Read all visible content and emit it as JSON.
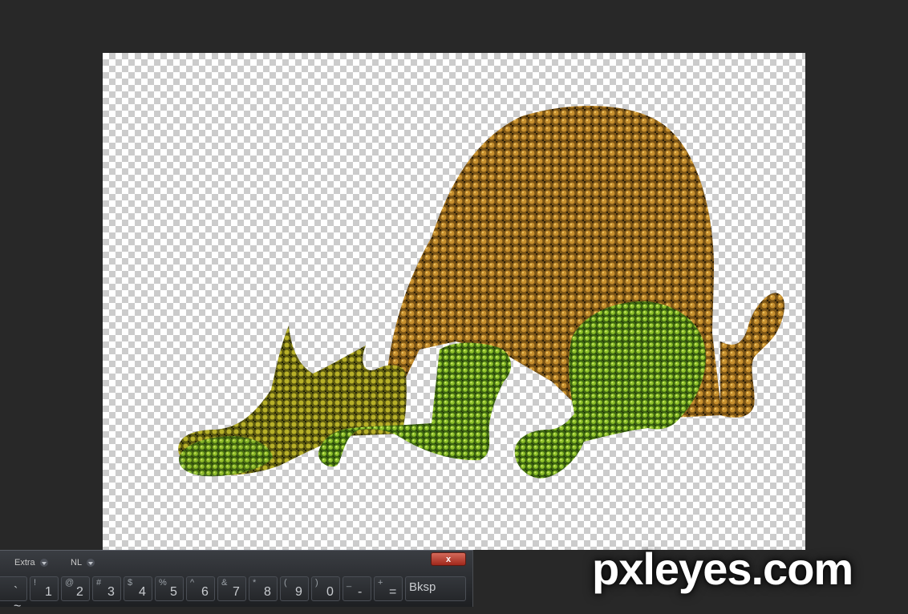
{
  "canvas": {
    "figure": "textured-animal-illustration"
  },
  "keyboard": {
    "dropdown_extra": "Extra",
    "dropdown_layout": "NL",
    "close_label": "x",
    "keys": [
      {
        "top": "",
        "main": "` ~"
      },
      {
        "top": "!",
        "main": "1"
      },
      {
        "top": "@",
        "main": "2"
      },
      {
        "top": "#",
        "main": "3"
      },
      {
        "top": "$",
        "main": "4"
      },
      {
        "top": "%",
        "main": "5"
      },
      {
        "top": "^",
        "main": "6"
      },
      {
        "top": "&",
        "main": "7"
      },
      {
        "top": "*",
        "main": "8"
      },
      {
        "top": "(",
        "main": "9"
      },
      {
        "top": ")",
        "main": "0"
      },
      {
        "top": "_",
        "main": "-"
      },
      {
        "top": "+",
        "main": "="
      },
      {
        "top": "",
        "main": "Bksp"
      }
    ]
  },
  "watermark": "pxleyes.com",
  "colors": {
    "workspace": "#282828",
    "checker_dark": "#cccccc",
    "checker_light": "#ffffff",
    "texture_brown": "#9a6a1e",
    "texture_green": "#6fa51e"
  }
}
